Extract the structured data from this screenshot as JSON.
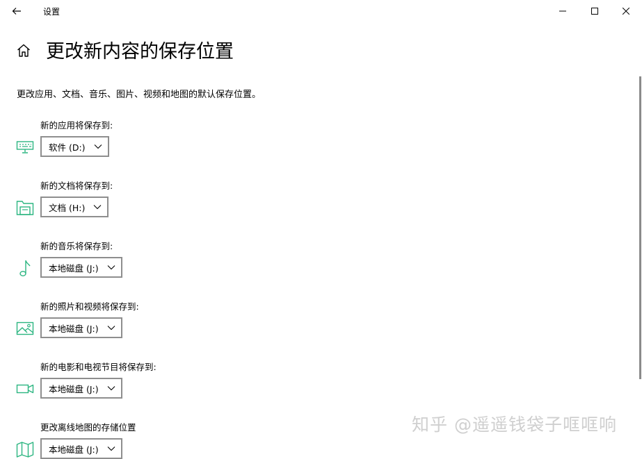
{
  "window": {
    "title": "设置"
  },
  "page": {
    "title": "更改新内容的保存位置",
    "description": "更改应用、文档、音乐、图片、视频和地图的默认保存位置。"
  },
  "settings": [
    {
      "label": "新的应用将保存到:",
      "value": "软件 (D:)",
      "icon": "monitor-icon"
    },
    {
      "label": "新的文档将保存到:",
      "value": "文档 (H:)",
      "icon": "folder-icon"
    },
    {
      "label": "新的音乐将保存到:",
      "value": "本地磁盘 (J:)",
      "icon": "music-note-icon"
    },
    {
      "label": "新的照片和视频将保存到:",
      "value": "本地磁盘 (J:)",
      "icon": "image-icon"
    },
    {
      "label": "新的电影和电视节目将保存到:",
      "value": "本地磁盘 (J:)",
      "icon": "video-camera-icon"
    },
    {
      "label": "更改离线地图的存储位置",
      "value": "本地磁盘 (J:)",
      "icon": "map-icon"
    }
  ],
  "watermark": "知乎 @遥遥钱袋子哐哐响",
  "colors": {
    "accent": "#2bb580",
    "border": "#8e8e8e"
  }
}
